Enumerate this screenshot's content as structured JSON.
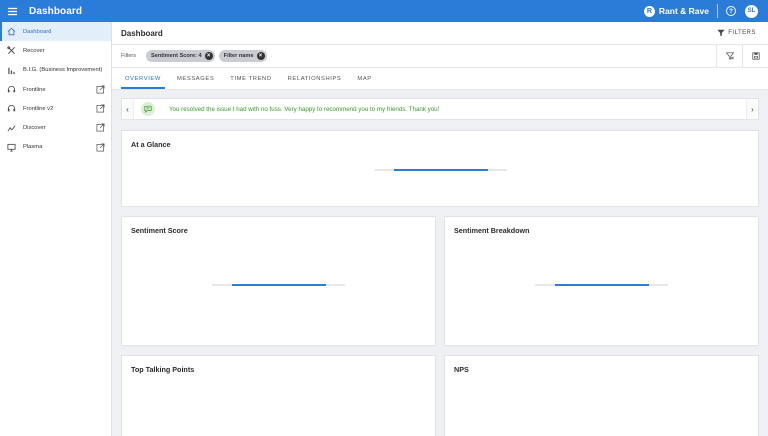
{
  "topbar": {
    "title": "Dashboard",
    "brand": "Rant & Rave",
    "brand_mark": "R",
    "help": "?",
    "user_initials": "SL"
  },
  "sidebar": {
    "items": [
      {
        "label": "Dashboard",
        "icon": "home-icon",
        "active": true,
        "external": false
      },
      {
        "label": "Recover",
        "icon": "tools-icon",
        "active": false,
        "external": false
      },
      {
        "label": "B.I.G. (Business Improvement)",
        "icon": "bar-chart-icon",
        "active": false,
        "external": false
      },
      {
        "label": "Frontline",
        "icon": "headset-icon",
        "active": false,
        "external": true
      },
      {
        "label": "Frontline v2",
        "icon": "headset-icon",
        "active": false,
        "external": true
      },
      {
        "label": "Discover",
        "icon": "trend-icon",
        "active": false,
        "external": true
      },
      {
        "label": "Plasma",
        "icon": "monitor-icon",
        "active": false,
        "external": true
      }
    ]
  },
  "header": {
    "title": "Dashboard",
    "filters_label": "FILTERS"
  },
  "filters": {
    "label": "Filters",
    "chips": [
      {
        "label": "Sentiment Score: 4"
      },
      {
        "label": "Filter name"
      }
    ]
  },
  "tabs": [
    {
      "label": "OVERVIEW",
      "active": true
    },
    {
      "label": "MESSAGES",
      "active": false
    },
    {
      "label": "TIME TREND",
      "active": false
    },
    {
      "label": "RELATIONSHIPS",
      "active": false
    },
    {
      "label": "MAP",
      "active": false
    }
  ],
  "banner": {
    "message": "You resolved the issue I had with no fuss. Very happy to recommend you to my friends. Thank you!"
  },
  "cards": {
    "at_a_glance": "At a Glance",
    "sentiment_score": "Sentiment Score",
    "sentiment_breakdown": "Sentiment Breakdown",
    "top_talking_points": "Top Talking Points",
    "nps": "NPS"
  },
  "colors": {
    "primary": "#2b7bd8",
    "positive_text": "#3d9a2e",
    "active_nav_bg": "#e3eefb"
  }
}
